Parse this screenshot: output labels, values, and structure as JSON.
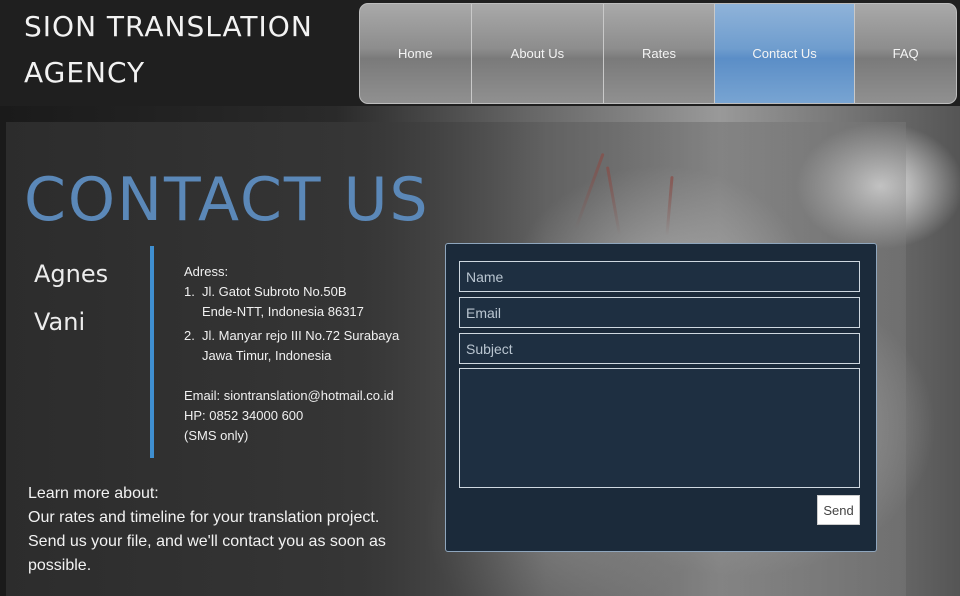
{
  "header": {
    "logo_line1": "SION TRANSLATION",
    "logo_line2": "AGENCY"
  },
  "nav": {
    "items": [
      {
        "label": "Home"
      },
      {
        "label": "About Us"
      },
      {
        "label": "Rates"
      },
      {
        "label": "Contact Us"
      },
      {
        "label": "FAQ"
      }
    ],
    "active": "Contact Us"
  },
  "main": {
    "title": "CONTACT US",
    "names": [
      "Agnes",
      "Vani"
    ],
    "address_label": "Adress:",
    "addresses": [
      {
        "num": "1.",
        "line1": "Jl. Gatot Subroto No.50B",
        "line2": "Ende-NTT, Indonesia 86317"
      },
      {
        "num": "2.",
        "line1": "Jl. Manyar rejo III No.72 Surabaya",
        "line2": "Jawa Timur, Indonesia"
      }
    ],
    "email": "Email: siontranslation@hotmail.co.id",
    "phone": "HP: 0852 34000 600",
    "phone_note": "(SMS only)",
    "learn_heading": "Learn more about:",
    "learn_text": "Our rates and timeline for your translation project. Send us your file, and we'll contact you as soon as possible."
  },
  "form": {
    "name_placeholder": "Name",
    "email_placeholder": "Email",
    "subject_placeholder": "Subject",
    "message_placeholder": "",
    "send_label": "Send"
  },
  "colors": {
    "accent_blue": "#5b88b8",
    "divider_blue": "#3f8fd0",
    "form_bg": "#1b2a3a",
    "nav_active": "#6f9dce"
  }
}
